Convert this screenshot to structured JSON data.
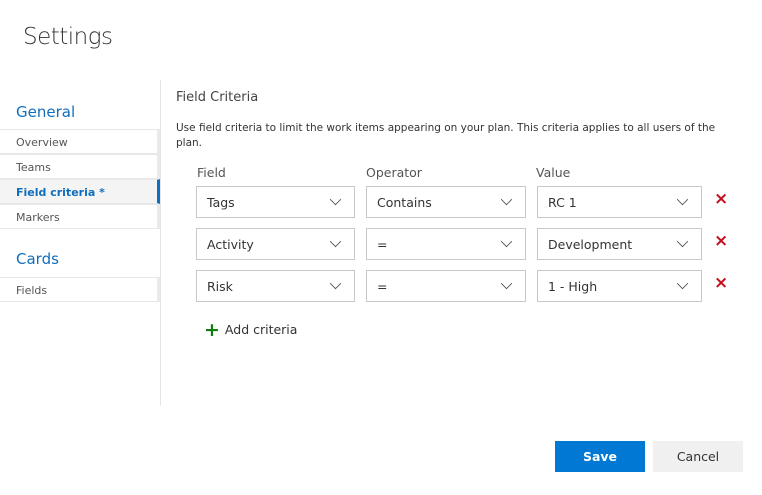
{
  "title": "Settings",
  "sidebar": {
    "sections": [
      {
        "label": "General",
        "items": [
          "Overview",
          "Teams",
          "Field criteria *",
          "Markers"
        ]
      },
      {
        "label": "Cards",
        "items": [
          "Fields"
        ]
      }
    ]
  },
  "main": {
    "heading": "Field Criteria",
    "description": "Use field criteria to limit the work items appearing on your plan. This criteria applies to all users of the plan.",
    "columns": {
      "field": "Field",
      "operator": "Operator",
      "value": "Value"
    },
    "rows": [
      {
        "field": "Tags",
        "operator": "Contains",
        "value": "RC 1"
      },
      {
        "field": "Activity",
        "operator": "=",
        "value": "Development"
      },
      {
        "field": "Risk",
        "operator": "=",
        "value": "1 - High"
      }
    ],
    "add_label": "Add criteria",
    "delete_icon": "×",
    "add_icon": "+"
  },
  "footer": {
    "save": "Save",
    "cancel": "Cancel"
  }
}
